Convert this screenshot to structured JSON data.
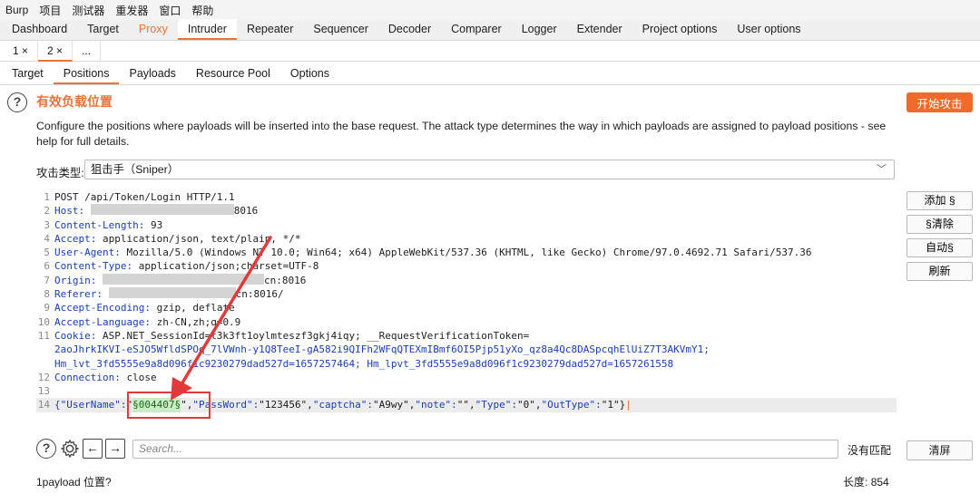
{
  "menu": [
    "Burp",
    "项目",
    "测试器",
    "重发器",
    "窗口",
    "帮助"
  ],
  "top_tabs": [
    "Dashboard",
    "Target",
    "Proxy",
    "Intruder",
    "Repeater",
    "Sequencer",
    "Decoder",
    "Comparer",
    "Logger",
    "Extender",
    "Project options",
    "User options"
  ],
  "num_tabs": [
    "1 ×",
    "2 ×",
    "..."
  ],
  "sub_tabs": [
    "Target",
    "Positions",
    "Payloads",
    "Resource Pool",
    "Options"
  ],
  "section": {
    "title": "有效负载位置",
    "start_button": "开始攻击",
    "description": "Configure the positions where payloads will be inserted into the base request. The attack type determines the way in which payloads are assigned to payload positions - see help for full details."
  },
  "attack": {
    "label": "攻击类型:",
    "value": "狙击手（Sniper）"
  },
  "request": {
    "l1": "POST /api/Token/Login HTTP/1.1",
    "l2_name": "Host:",
    "l2_tail": "8016",
    "l3_name": "Content-Length:",
    "l3_val": " 93",
    "l4_name": "Accept:",
    "l4_val": " application/json, text/plain, */*",
    "l5_name": "User-Agent:",
    "l5_val": " Mozilla/5.0 (Windows NT 10.0; Win64; x64) AppleWebKit/537.36 (KHTML, like Gecko) Chrome/97.0.4692.71 Safari/537.36",
    "l6_name": "Content-Type:",
    "l6_val": " application/json;charset=UTF-8",
    "l7_name": "Origin:",
    "l7_tail": "cn:8016",
    "l8_name": "Referer:",
    "l8_tail": "cn:8016/",
    "l9_name": "Accept-Encoding:",
    "l9_val": " gzip, deflate",
    "l10_name": "Accept-Language:",
    "l10_val": " zh-CN,zh;q=0.9",
    "l11_name": "Cookie:",
    "l11_val": " ASP.NET_SessionId=t3k3ft1oylmteszf3gkj4iqy; __RequestVerificationToken=",
    "l11b": "2aoJhrkIKVI-eSJO5WfldSPOq_7lVWnh-y1Q8TeeI-gA582i9QIFh2WFqQTEXmIBmf6OI5Pjp51yXo_qz8a4Qc8DASpcqhElUiZ7T3AKVmY1;",
    "l11c": "Hm_lvt_3fd5555e9a8d096f1c9230279dad527d=1657257464; Hm_lpvt_3fd5555e9a8d096f1c9230279dad527d=1657261558",
    "l12_name": "Connection:",
    "l12_val": " close",
    "l14_key1": "{\"UserName\":",
    "l14_pre": "\"",
    "l14_payload": "§004407§",
    "l14_post": "\",",
    "l14_rest_k1": "\"PassWord\":",
    "l14_rest_v1": "\"123456\",",
    "l14_rest_k2": "\"captcha\":",
    "l14_rest_v2": "\"A9wy\",",
    "l14_rest_k3": "\"note\":",
    "l14_rest_v3": "\"\",",
    "l14_rest_k4": "\"Type\":",
    "l14_rest_v4": "\"0\",",
    "l14_rest_k5": "\"OutType\":",
    "l14_rest_v5": "\"1\"}"
  },
  "side_buttons": {
    "add": "添加 §",
    "clear": "§清除",
    "auto": "自动§",
    "refresh": "刷新"
  },
  "search": {
    "placeholder": "Search...",
    "no_match": "没有匹配",
    "clear_screen": "清屏"
  },
  "status": {
    "positions": "1payload 位置?",
    "length_label": "长度:",
    "length_value": "854"
  },
  "colors": {
    "accent": "#e8743b",
    "start_button": "#f06a2b",
    "annotation": "#e23a3a",
    "payload_bg": "#c9ecc6"
  }
}
